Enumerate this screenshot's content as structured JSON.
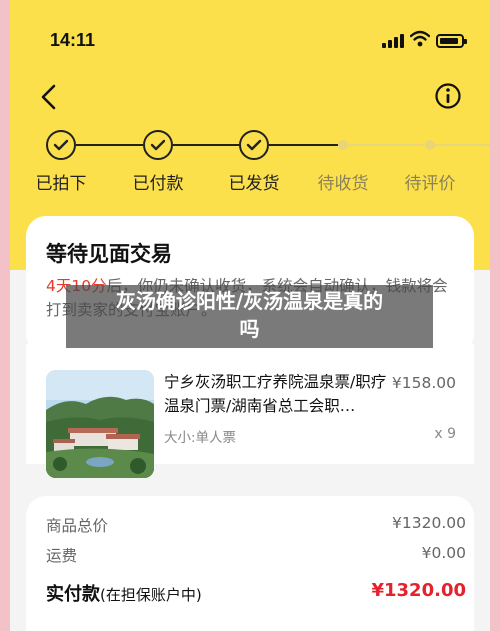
{
  "status_bar": {
    "time": "14:11"
  },
  "nav": {
    "back_icon": "chevron-left-icon",
    "info_icon": "info-circle-icon"
  },
  "steps": [
    {
      "label": "已拍下",
      "done": true
    },
    {
      "label": "已付款",
      "done": true
    },
    {
      "label": "已发货",
      "done": true
    },
    {
      "label": "待收货",
      "done": false
    },
    {
      "label": "待评价",
      "done": false
    }
  ],
  "order_status": {
    "title": "等待见面交易",
    "desc_highlight": "4天10分",
    "desc_rest": "后，你仍未确认收货，系统会自动确认，钱款将会打到卖家的支付宝账户。"
  },
  "product": {
    "title": "宁乡灰汤职工疗养院温泉票/职疗温泉门票/湖南省总工会职…",
    "price": "¥158.00",
    "spec": "大小:单人票",
    "qty": "x 9"
  },
  "summary": {
    "goods_total_label": "商品总价",
    "goods_total_value": "¥1320.00",
    "shipping_label": "运费",
    "shipping_value": "¥0.00",
    "paid_label": "实付款",
    "paid_note": "(在担保账户中)",
    "paid_value": "¥1320.00"
  },
  "overlay": {
    "line1": "灰汤确诊阳性/灰汤温泉是真的",
    "line2": "吗"
  },
  "colors": {
    "header": "#fbe04b",
    "accent_red": "#e3222c",
    "background": "#f3c2c8"
  }
}
